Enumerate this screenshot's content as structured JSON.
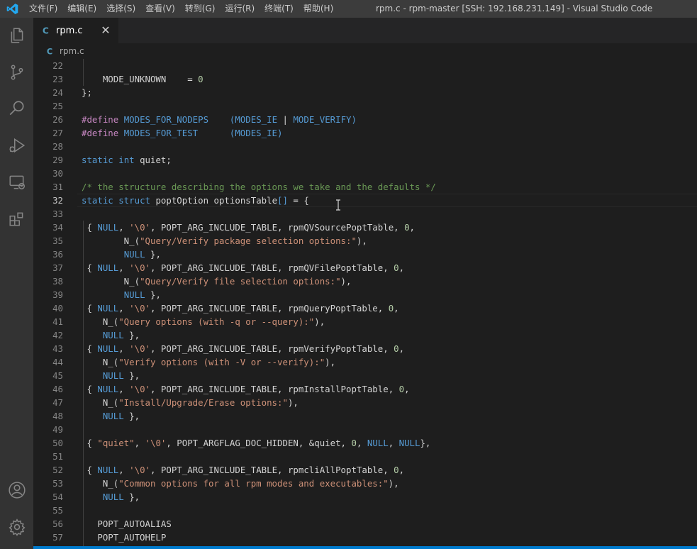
{
  "menubar": {
    "items": [
      "文件(F)",
      "编辑(E)",
      "选择(S)",
      "查看(V)",
      "转到(G)",
      "运行(R)",
      "终端(T)",
      "帮助(H)"
    ]
  },
  "window": {
    "title": "rpm.c - rpm-master [SSH: 192.168.231.149] - Visual Studio Code"
  },
  "activitybar": {
    "icons": [
      "explorer-icon",
      "source-control-icon",
      "search-icon",
      "run-debug-icon",
      "remote-explorer-icon",
      "extensions-icon",
      "account-icon",
      "settings-gear-icon"
    ]
  },
  "tabs": [
    {
      "label": "rpm.c",
      "active": true
    }
  ],
  "breadcrumb": {
    "file": "rpm.c"
  },
  "editor": {
    "current_line": "32",
    "lines": [
      {
        "n": "22",
        "tokens": []
      },
      {
        "n": "23",
        "tokens": [
          {
            "t": "    MODE_UNKNOWN    = ",
            "c": "default"
          },
          {
            "t": "0",
            "c": "number"
          }
        ]
      },
      {
        "n": "24",
        "tokens": [
          {
            "t": "};",
            "c": "default"
          }
        ]
      },
      {
        "n": "25",
        "tokens": []
      },
      {
        "n": "26",
        "tokens": [
          {
            "t": "#define",
            "c": "macro"
          },
          {
            "t": " ",
            "c": "default"
          },
          {
            "t": "MODES_FOR_NODEPS",
            "c": "define-name"
          },
          {
            "t": "    (",
            "c": "define-name"
          },
          {
            "t": "MODES_IE",
            "c": "define-name"
          },
          {
            "t": " | ",
            "c": "default"
          },
          {
            "t": "MODE_VERIFY",
            "c": "define-name"
          },
          {
            "t": ")",
            "c": "define-name"
          }
        ]
      },
      {
        "n": "27",
        "tokens": [
          {
            "t": "#define",
            "c": "macro"
          },
          {
            "t": " ",
            "c": "default"
          },
          {
            "t": "MODES_FOR_TEST",
            "c": "define-name"
          },
          {
            "t": "      (",
            "c": "define-name"
          },
          {
            "t": "MODES_IE",
            "c": "define-name"
          },
          {
            "t": ")",
            "c": "define-name"
          }
        ]
      },
      {
        "n": "28",
        "tokens": []
      },
      {
        "n": "29",
        "tokens": [
          {
            "t": "static",
            "c": "keyword"
          },
          {
            "t": " ",
            "c": "default"
          },
          {
            "t": "int",
            "c": "keyword"
          },
          {
            "t": " quiet;",
            "c": "default"
          }
        ]
      },
      {
        "n": "30",
        "tokens": []
      },
      {
        "n": "31",
        "tokens": [
          {
            "t": "/* the structure describing the options we take and the defaults */",
            "c": "comment"
          }
        ]
      },
      {
        "n": "32",
        "tokens": [
          {
            "t": "static",
            "c": "keyword"
          },
          {
            "t": " ",
            "c": "default"
          },
          {
            "t": "struct",
            "c": "keyword"
          },
          {
            "t": " poptOption optionsTable",
            "c": "default"
          },
          {
            "t": "[]",
            "c": "keyword"
          },
          {
            "t": " = ",
            "c": "default"
          },
          {
            "t": "{",
            "c": "bracket"
          }
        ]
      },
      {
        "n": "33",
        "tokens": []
      },
      {
        "n": "34",
        "tokens": [
          {
            "t": " { ",
            "c": "default"
          },
          {
            "t": "NULL",
            "c": "keyword"
          },
          {
            "t": ", ",
            "c": "default"
          },
          {
            "t": "'\\0'",
            "c": "string"
          },
          {
            "t": ", POPT_ARG_INCLUDE_TABLE, rpmQVSourcePoptTable, ",
            "c": "default"
          },
          {
            "t": "0",
            "c": "number"
          },
          {
            "t": ",",
            "c": "default"
          }
        ]
      },
      {
        "n": "35",
        "tokens": [
          {
            "t": "        N_(",
            "c": "default"
          },
          {
            "t": "\"Query/Verify package selection options:\"",
            "c": "string"
          },
          {
            "t": "),",
            "c": "default"
          }
        ]
      },
      {
        "n": "36",
        "tokens": [
          {
            "t": "        ",
            "c": "default"
          },
          {
            "t": "NULL",
            "c": "keyword"
          },
          {
            "t": " },",
            "c": "default"
          }
        ]
      },
      {
        "n": "37",
        "tokens": [
          {
            "t": " { ",
            "c": "default"
          },
          {
            "t": "NULL",
            "c": "keyword"
          },
          {
            "t": ", ",
            "c": "default"
          },
          {
            "t": "'\\0'",
            "c": "string"
          },
          {
            "t": ", POPT_ARG_INCLUDE_TABLE, rpmQVFilePoptTable, ",
            "c": "default"
          },
          {
            "t": "0",
            "c": "number"
          },
          {
            "t": ",",
            "c": "default"
          }
        ]
      },
      {
        "n": "38",
        "tokens": [
          {
            "t": "        N_(",
            "c": "default"
          },
          {
            "t": "\"Query/Verify file selection options:\"",
            "c": "string"
          },
          {
            "t": "),",
            "c": "default"
          }
        ]
      },
      {
        "n": "39",
        "tokens": [
          {
            "t": "        ",
            "c": "default"
          },
          {
            "t": "NULL",
            "c": "keyword"
          },
          {
            "t": " },",
            "c": "default"
          }
        ]
      },
      {
        "n": "40",
        "tokens": [
          {
            "t": " { ",
            "c": "default"
          },
          {
            "t": "NULL",
            "c": "keyword"
          },
          {
            "t": ", ",
            "c": "default"
          },
          {
            "t": "'\\0'",
            "c": "string"
          },
          {
            "t": ", POPT_ARG_INCLUDE_TABLE, rpmQueryPoptTable, ",
            "c": "default"
          },
          {
            "t": "0",
            "c": "number"
          },
          {
            "t": ",",
            "c": "default"
          }
        ]
      },
      {
        "n": "41",
        "tokens": [
          {
            "t": "    N_(",
            "c": "default"
          },
          {
            "t": "\"Query options (with -q or --query):\"",
            "c": "string"
          },
          {
            "t": "),",
            "c": "default"
          }
        ]
      },
      {
        "n": "42",
        "tokens": [
          {
            "t": "    ",
            "c": "default"
          },
          {
            "t": "NULL",
            "c": "keyword"
          },
          {
            "t": " },",
            "c": "default"
          }
        ]
      },
      {
        "n": "43",
        "tokens": [
          {
            "t": " { ",
            "c": "default"
          },
          {
            "t": "NULL",
            "c": "keyword"
          },
          {
            "t": ", ",
            "c": "default"
          },
          {
            "t": "'\\0'",
            "c": "string"
          },
          {
            "t": ", POPT_ARG_INCLUDE_TABLE, rpmVerifyPoptTable, ",
            "c": "default"
          },
          {
            "t": "0",
            "c": "number"
          },
          {
            "t": ",",
            "c": "default"
          }
        ]
      },
      {
        "n": "44",
        "tokens": [
          {
            "t": "    N_(",
            "c": "default"
          },
          {
            "t": "\"Verify options (with -V or --verify):\"",
            "c": "string"
          },
          {
            "t": "),",
            "c": "default"
          }
        ]
      },
      {
        "n": "45",
        "tokens": [
          {
            "t": "    ",
            "c": "default"
          },
          {
            "t": "NULL",
            "c": "keyword"
          },
          {
            "t": " },",
            "c": "default"
          }
        ]
      },
      {
        "n": "46",
        "tokens": [
          {
            "t": " { ",
            "c": "default"
          },
          {
            "t": "NULL",
            "c": "keyword"
          },
          {
            "t": ", ",
            "c": "default"
          },
          {
            "t": "'\\0'",
            "c": "string"
          },
          {
            "t": ", POPT_ARG_INCLUDE_TABLE, rpmInstallPoptTable, ",
            "c": "default"
          },
          {
            "t": "0",
            "c": "number"
          },
          {
            "t": ",",
            "c": "default"
          }
        ]
      },
      {
        "n": "47",
        "tokens": [
          {
            "t": "    N_(",
            "c": "default"
          },
          {
            "t": "\"Install/Upgrade/Erase options:\"",
            "c": "string"
          },
          {
            "t": "),",
            "c": "default"
          }
        ]
      },
      {
        "n": "48",
        "tokens": [
          {
            "t": "    ",
            "c": "default"
          },
          {
            "t": "NULL",
            "c": "keyword"
          },
          {
            "t": " },",
            "c": "default"
          }
        ]
      },
      {
        "n": "49",
        "tokens": []
      },
      {
        "n": "50",
        "tokens": [
          {
            "t": " { ",
            "c": "default"
          },
          {
            "t": "\"quiet\"",
            "c": "string"
          },
          {
            "t": ", ",
            "c": "default"
          },
          {
            "t": "'\\0'",
            "c": "string"
          },
          {
            "t": ", POPT_ARGFLAG_DOC_HIDDEN, &quiet, ",
            "c": "default"
          },
          {
            "t": "0",
            "c": "number"
          },
          {
            "t": ", ",
            "c": "default"
          },
          {
            "t": "NULL",
            "c": "keyword"
          },
          {
            "t": ", ",
            "c": "default"
          },
          {
            "t": "NULL",
            "c": "keyword"
          },
          {
            "t": "},",
            "c": "default"
          }
        ]
      },
      {
        "n": "51",
        "tokens": []
      },
      {
        "n": "52",
        "tokens": [
          {
            "t": " { ",
            "c": "default"
          },
          {
            "t": "NULL",
            "c": "keyword"
          },
          {
            "t": ", ",
            "c": "default"
          },
          {
            "t": "'\\0'",
            "c": "string"
          },
          {
            "t": ", POPT_ARG_INCLUDE_TABLE, rpmcliAllPoptTable, ",
            "c": "default"
          },
          {
            "t": "0",
            "c": "number"
          },
          {
            "t": ",",
            "c": "default"
          }
        ]
      },
      {
        "n": "53",
        "tokens": [
          {
            "t": "    N_(",
            "c": "default"
          },
          {
            "t": "\"Common options for all rpm modes and executables:\"",
            "c": "string"
          },
          {
            "t": "),",
            "c": "default"
          }
        ]
      },
      {
        "n": "54",
        "tokens": [
          {
            "t": "    ",
            "c": "default"
          },
          {
            "t": "NULL",
            "c": "keyword"
          },
          {
            "t": " },",
            "c": "default"
          }
        ]
      },
      {
        "n": "55",
        "tokens": []
      },
      {
        "n": "56",
        "tokens": [
          {
            "t": "   POPT_AUTOALIAS",
            "c": "default"
          }
        ]
      },
      {
        "n": "57",
        "tokens": [
          {
            "t": "   POPT_AUTOHELP",
            "c": "default"
          }
        ]
      }
    ]
  },
  "colors": {
    "accent": "#007acc",
    "titlebar": "#3c3c3c",
    "activitybar": "#333333",
    "editor_bg": "#1e1e1e",
    "c_file_icon": "#519aba"
  }
}
